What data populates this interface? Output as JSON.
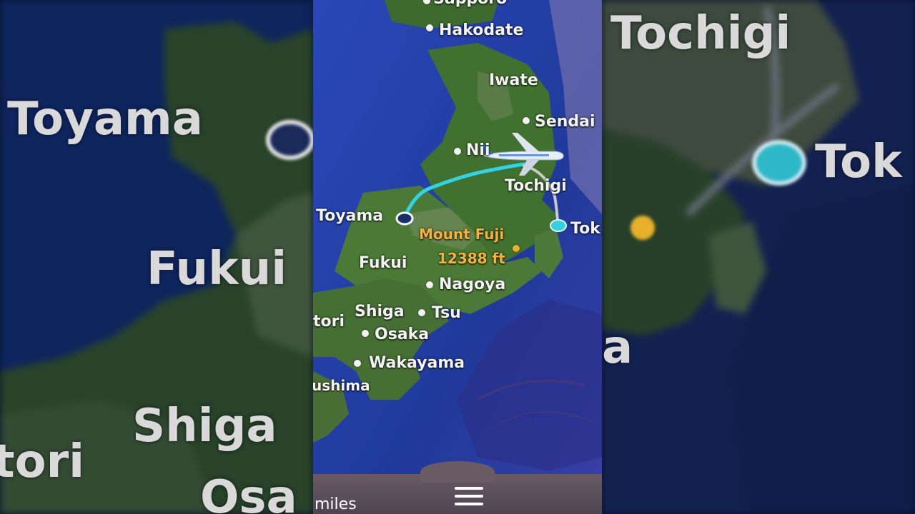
{
  "map": {
    "cities": {
      "sapporo": "Sapporo",
      "hakodate": "Hakodate",
      "iwate": "Iwate",
      "sendai": "Sendai",
      "niigata": "Nii",
      "tochigi": "Tochigi",
      "toyama": "Toyama",
      "tokyo": "Tok",
      "fukui": "Fukui",
      "nagoya": "Nagoya",
      "shiga": "Shiga",
      "tsu": "Tsu",
      "tottori": "tori",
      "osaka": "Osaka",
      "wakayama": "Wakayama",
      "tokushima": "ushima"
    },
    "landmark": {
      "name": "Mount Fuji",
      "elevation": "12388 ft"
    },
    "route": {
      "origin": "Toyama",
      "destination": "Tok",
      "flown_color": "#2fd3e6",
      "remaining_color": "#c9c9c9"
    }
  },
  "bottom_bar": {
    "units": "miles",
    "menu_icon": "hamburger-menu-icon"
  },
  "background_blur": {
    "left_labels": [
      "Toyama",
      "Fukui",
      "Shiga",
      "tori",
      "Osa"
    ],
    "right_labels": [
      "Tochigi",
      "Tok",
      "a"
    ]
  },
  "colors": {
    "ocean": "#1b2f8a",
    "land": "#3e6a2a",
    "label": "#f3f3f3",
    "landmark": "#f4b23a"
  }
}
